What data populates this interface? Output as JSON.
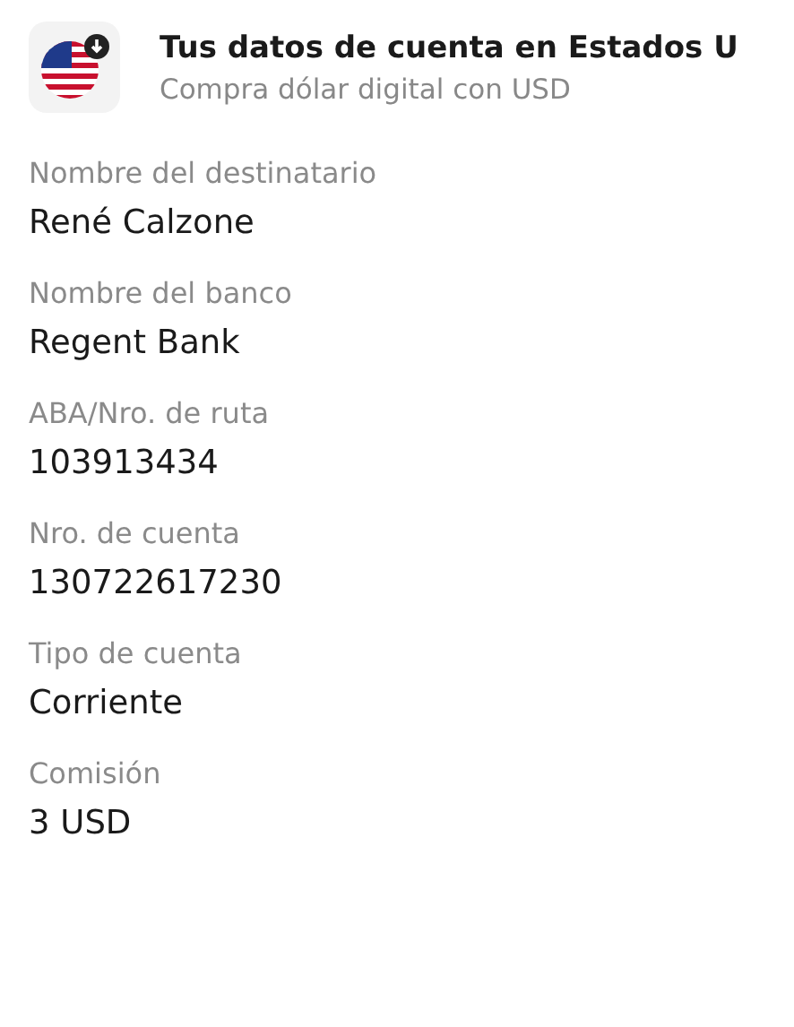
{
  "header": {
    "title": "Tus datos de cuenta en Estados U",
    "subtitle": "Compra dólar digital con USD"
  },
  "fields": [
    {
      "label": "Nombre del destinatario",
      "value": "René Calzone"
    },
    {
      "label": "Nombre del banco",
      "value": "Regent Bank"
    },
    {
      "label": "ABA/Nro. de ruta",
      "value": "103913434"
    },
    {
      "label": "Nro. de cuenta",
      "value": "130722617230"
    },
    {
      "label": "Tipo de cuenta",
      "value": "Corriente"
    },
    {
      "label": "Comisión",
      "value": "3 USD"
    }
  ]
}
